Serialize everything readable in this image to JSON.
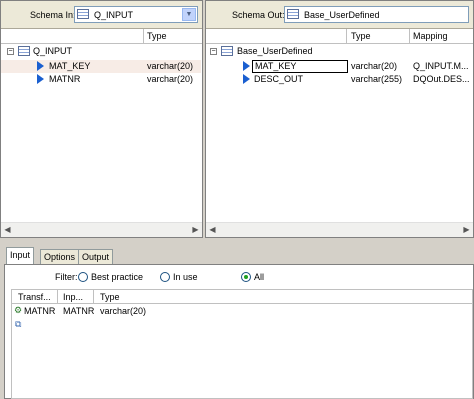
{
  "left_panel": {
    "schema_label": "Schema In:",
    "schema_value": "Q_INPUT",
    "col_type": "Type",
    "root": "Q_INPUT",
    "rows": [
      {
        "name": "MAT_KEY",
        "type": "varchar(20)"
      },
      {
        "name": "MATNR",
        "type": "varchar(20)"
      }
    ]
  },
  "right_panel": {
    "schema_label": "Schema Out:",
    "schema_value": "Base_UserDefined",
    "col_type": "Type",
    "col_mapping": "Mapping",
    "root": "Base_UserDefined",
    "rows": [
      {
        "name": "MAT_KEY",
        "type": "varchar(20)",
        "mapping": "Q_INPUT.M..."
      },
      {
        "name": "DESC_OUT",
        "type": "varchar(255)",
        "mapping": "DQOut.DES..."
      }
    ]
  },
  "tabs": [
    "Input",
    "Options",
    "Output"
  ],
  "filter": {
    "label": "Filter:",
    "options": [
      "Best practice",
      "In use",
      "All"
    ],
    "selected": "All"
  },
  "grid": {
    "columns": [
      "Transf...",
      "Inp...",
      "Type"
    ],
    "rows": [
      {
        "transform": "MATNR",
        "input": "MATNR",
        "type": "varchar(20)"
      }
    ]
  },
  "colors": {
    "chrome": "#d4d0c8",
    "selection": "#f7ece6",
    "accent": "#1a5fd0"
  }
}
